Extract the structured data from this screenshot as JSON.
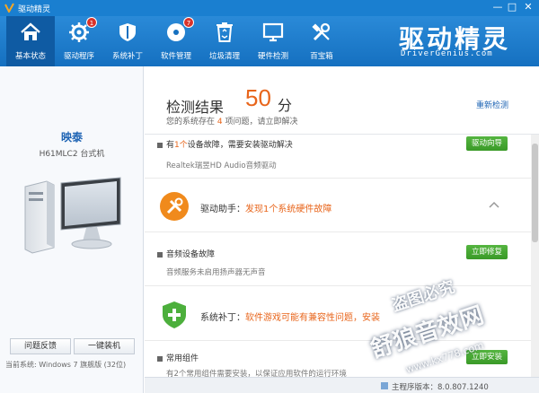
{
  "window": {
    "title": "驱动精灵",
    "controls": [
      "minimize-icon",
      "maximize-icon",
      "close-icon"
    ]
  },
  "toolbar": {
    "items": [
      {
        "label": "基本状态",
        "icon": "home-icon",
        "active": true
      },
      {
        "label": "驱动程序",
        "icon": "gear-icon",
        "badge": "1"
      },
      {
        "label": "系统补丁",
        "icon": "shield-icon"
      },
      {
        "label": "软件管理",
        "icon": "disc-icon",
        "badge": "7"
      },
      {
        "label": "垃圾清理",
        "icon": "recycle-bin-icon"
      },
      {
        "label": "硬件检测",
        "icon": "monitor-icon"
      },
      {
        "label": "百宝箱",
        "icon": "tools-icon"
      }
    ]
  },
  "brand": {
    "name_cn": "驱动精灵",
    "url": "DriverGenius.com"
  },
  "sidebar": {
    "pc_brand": "映泰",
    "pc_model": "H61MLC2 台式机",
    "feedback_label": "问题反馈",
    "install_label": "一键装机",
    "os_label": "当前系统:",
    "os_value": "Windows 7 旗舰版 (32位)"
  },
  "result": {
    "title": "检测结果",
    "score": "50",
    "score_unit": "分",
    "sub_prefix": "您的系统存在",
    "issue_count": "4",
    "sub_suffix": "项问题，请立即解决",
    "recheck_label": "重新检测"
  },
  "rows": {
    "device": {
      "prefix": "有",
      "count": "1个",
      "text": "设备故障，需要安装驱动解决",
      "button": "驱动向导",
      "desc": "Realtek瑞昱HD Audio音频驱动"
    },
    "driver_helper": {
      "title": "驱动助手：",
      "warning": "发现1个系统硬件故障"
    },
    "audio": {
      "title": "音频设备故障",
      "button": "立即修复",
      "desc": "音频服务未启用扬声器无声音"
    },
    "patch": {
      "title": "系统补丁：",
      "warning": "软件游戏可能有兼容性问题，安装"
    },
    "components": {
      "title": "常用组件",
      "button": "立即安装",
      "desc": "有2个常用组件需要安装，以保证应用软件的运行环境"
    }
  },
  "statusbar": {
    "version": "主程序版本：8.0.807.1240"
  },
  "watermark": {
    "line1": "盗图必究",
    "line2": "舒狼音效网",
    "line3": "www.kx778.com"
  },
  "colors": {
    "title_bar": "#1a7fd0",
    "accent_orange": "#e8651b",
    "green_button": "#3a9a28",
    "link_blue": "#1e64b4"
  }
}
